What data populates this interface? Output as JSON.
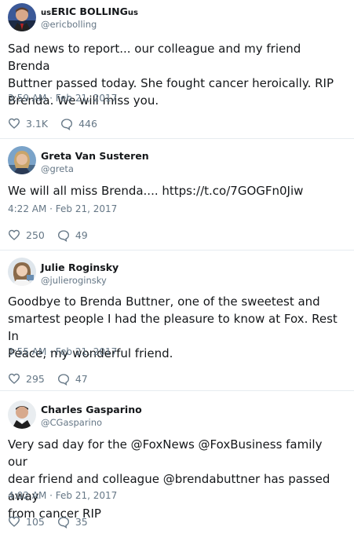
{
  "tweets": [
    {
      "name_prefix": "us",
      "name": "ERIC BOLLING",
      "name_suffix": "us",
      "handle": "@ericbolling",
      "body_lines": [
        "Sad news to report... our colleague and my friend Brenda",
        "Buttner passed today. She fought cancer heroically. RIP",
        "Brenda. We will miss you."
      ],
      "time": "3:59 AM · Feb 21, 2017",
      "likes": "3.1K",
      "replies": "446"
    },
    {
      "name": "Greta Van Susteren",
      "handle": "@greta",
      "body_lines": [
        "We will all miss Brenda.... https://t.co/7GOGFn0Jiw"
      ],
      "time": "4:22 AM · Feb 21, 2017",
      "likes": "250",
      "replies": "49"
    },
    {
      "name": "Julie Roginsky",
      "handle": "@julieroginsky",
      "body_lines": [
        "Goodbye to Brenda Buttner, one of the sweetest and",
        "smartest people I had the pleasure to know at Fox. Rest In",
        "Peace, my wonderful friend."
      ],
      "time": "3:55 AM · Feb 21, 2017",
      "likes": "295",
      "replies": "47"
    },
    {
      "name": "Charles Gasparino",
      "handle": "@CGasparino",
      "body_lines": [
        "Very sad day for the @FoxNews @FoxBusiness family our",
        "dear friend and colleague @brendabuttner has passed away",
        "from cancer RIP"
      ],
      "time": "4:02 AM · Feb 21, 2017",
      "likes": "105",
      "replies": "35"
    }
  ],
  "colors": {
    "text": "#14171a",
    "muted": "#657786",
    "divider": "#e6ecf0",
    "link": "#14171a"
  },
  "icons": {
    "like": "heart-icon",
    "reply": "reply-bubble-icon"
  }
}
